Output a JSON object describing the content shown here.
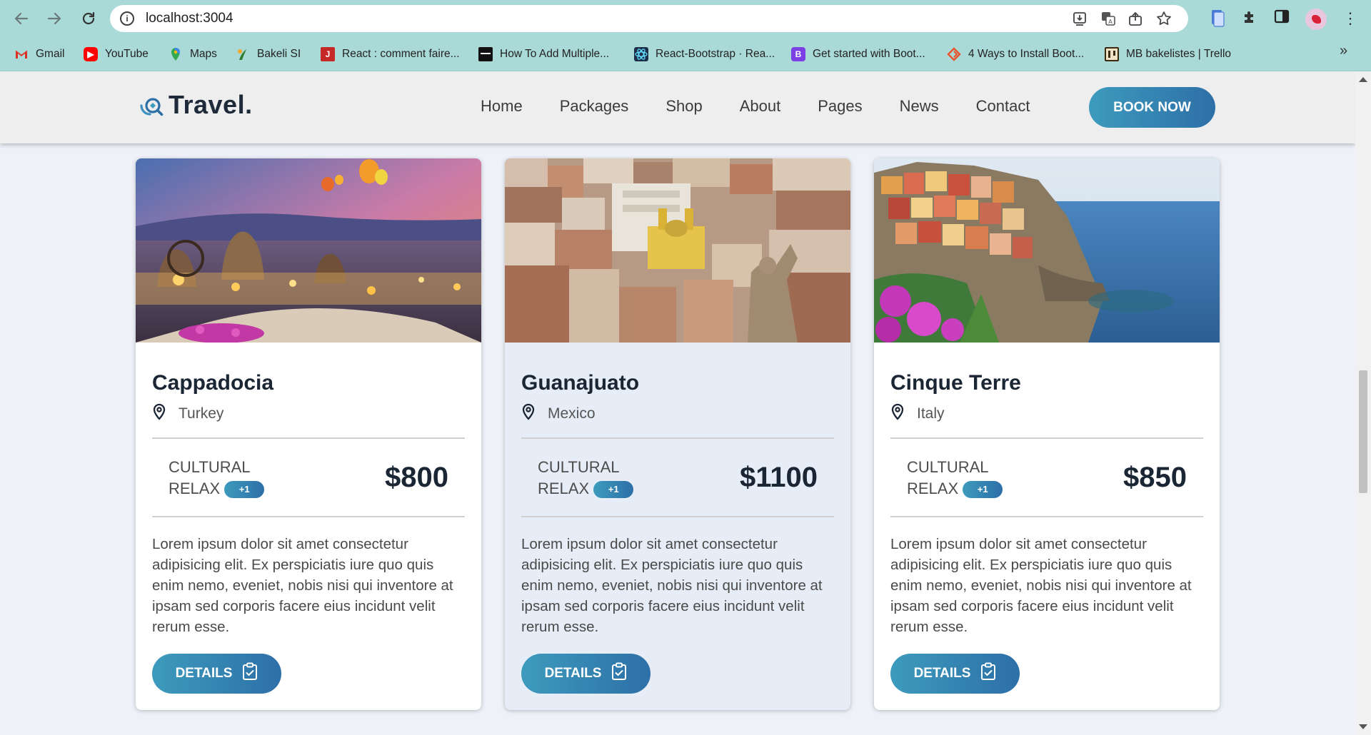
{
  "browser": {
    "url": "localhost:3004",
    "bookmarks": [
      {
        "label": "Gmail",
        "icon": "gmail-icon"
      },
      {
        "label": "YouTube",
        "icon": "youtube-icon"
      },
      {
        "label": "Maps",
        "icon": "maps-icon"
      },
      {
        "label": "Bakeli SI",
        "icon": "bakeli-icon"
      },
      {
        "label": "React : comment faire...",
        "icon": "react-j-icon"
      },
      {
        "label": "How To Add Multiple...",
        "icon": "dev-icon"
      },
      {
        "label": "React-Bootstrap · Rea...",
        "icon": "react-bootstrap-icon"
      },
      {
        "label": "Get started with Boot...",
        "icon": "bootstrap-icon"
      },
      {
        "label": "4 Ways to Install Boot...",
        "icon": "diamond-icon"
      },
      {
        "label": "MB bakelistes | Trello",
        "icon": "trello-icon"
      }
    ]
  },
  "site": {
    "logo": "Travel.",
    "menu": [
      "Home",
      "Packages",
      "Shop",
      "About",
      "Pages",
      "News",
      "Contact"
    ],
    "cta": "BOOK NOW"
  },
  "cards": [
    {
      "title": "Cappadocia",
      "location": "Turkey",
      "tag1": "CULTURAL",
      "tag2": "RELAX",
      "badge": "+1",
      "price": "$800",
      "description": "Lorem ipsum dolor sit amet consectetur adipisicing elit. Ex perspiciatis iure quo quis enim nemo, eveniet, nobis nisi qui inventore at ipsam sed corporis facere eius incidunt velit rerum esse.",
      "button": "DETAILS"
    },
    {
      "title": "Guanajuato",
      "location": "Mexico",
      "tag1": "CULTURAL",
      "tag2": "RELAX",
      "badge": "+1",
      "price": "$1100",
      "description": "Lorem ipsum dolor sit amet consectetur adipisicing elit. Ex perspiciatis iure quo quis enim nemo, eveniet, nobis nisi qui inventore at ipsam sed corporis facere eius incidunt velit rerum esse.",
      "button": "DETAILS"
    },
    {
      "title": "Cinque Terre",
      "location": "Italy",
      "tag1": "CULTURAL",
      "tag2": "RELAX",
      "badge": "+1",
      "price": "$850",
      "description": "Lorem ipsum dolor sit amet consectetur adipisicing elit. Ex perspiciatis iure quo quis enim nemo, eveniet, nobis nisi qui inventore at ipsam sed corporis facere eius incidunt velit rerum esse.",
      "button": "DETAILS"
    }
  ],
  "colors": {
    "accent_start": "#3d9bbd",
    "accent_end": "#2d6fa7",
    "heading": "#1b2635",
    "chrome": "#aadad8"
  }
}
